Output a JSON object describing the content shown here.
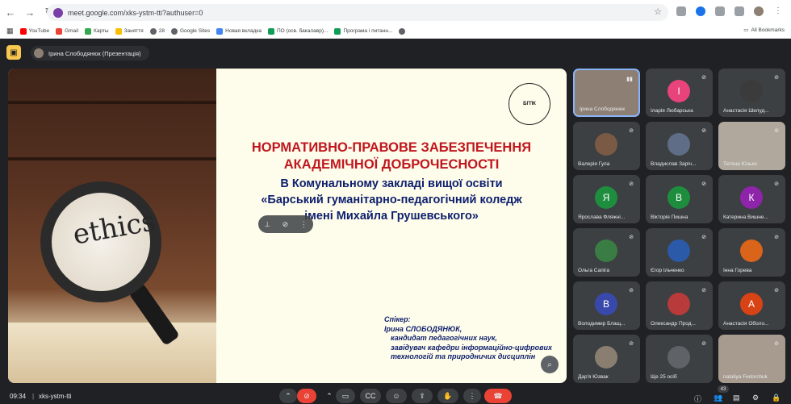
{
  "browser": {
    "url": "meet.google.com/xks-ystm-tti?authuser=0",
    "bookmarks": [
      "YouTube",
      "Gmail",
      "Карты",
      "Заняття",
      "28",
      "Google Sites",
      "Новая вкладка",
      "ПО (осв. бакалавр)...",
      "Програма і питанн..."
    ],
    "all_bookmarks": "All Bookmarks"
  },
  "meet": {
    "presenter_chip": "Ірина Слободянюк (Презентація)",
    "meeting_code": "xks-ystm-tti",
    "time": "09:34",
    "participant_count": "43"
  },
  "slide": {
    "image_word": "ethics",
    "logo_text": "БГПК",
    "title_red": [
      "НОРМАТИВНО-ПРАВОВЕ ЗАБЕЗПЕЧЕННЯ",
      "АКАДЕМІЧНОЇ ДОБРОЧЕСНОСТІ"
    ],
    "title_blue": [
      "В Комунальному закладі вищої освіти",
      "«Барський гуманітарно-педагогічний коледж",
      "імені Михайла Грушевського»"
    ],
    "speaker_label": "Спікер:",
    "speaker_name": "Ірина СЛОБОДЯНЮК,",
    "speaker_lines": [
      "кандидат педагогічних наук,",
      "завідувач кафедри інформаційно-цифрових",
      "технологій та природничих дисциплін"
    ]
  },
  "participants": [
    {
      "name": "Ірина Слободянюк",
      "initial": "",
      "color": "#8d7f73"
    },
    {
      "name": "Іларія Любарська",
      "initial": "І",
      "color": "#e8437a"
    },
    {
      "name": "Анастасія Шелуд...",
      "initial": "",
      "color": "#3b3b3b"
    },
    {
      "name": "Валерія Гула",
      "initial": "",
      "color": "#7a5a45"
    },
    {
      "name": "Владислав Заріч...",
      "initial": "",
      "color": "#5f6e86"
    },
    {
      "name": "Тетяна Юзько",
      "initial": "",
      "color": "#b0a89c"
    },
    {
      "name": "Ярослава Фляжні...",
      "initial": "Я",
      "color": "#1e8e3e"
    },
    {
      "name": "Вікторія Пишна",
      "initial": "В",
      "color": "#1e8e3e"
    },
    {
      "name": "Катерина Вишне...",
      "initial": "К",
      "color": "#8e24aa"
    },
    {
      "name": "Ольга Сапіга",
      "initial": "",
      "color": "#3a7d44"
    },
    {
      "name": "Єгор Ільченко",
      "initial": "",
      "color": "#2b5aa8"
    },
    {
      "name": "Інна Горева",
      "initial": "",
      "color": "#d9641a"
    },
    {
      "name": "Володимир Блащ...",
      "initial": "В",
      "color": "#3949ab"
    },
    {
      "name": "Олександр Прод...",
      "initial": "",
      "color": "#b83a3a"
    },
    {
      "name": "Анастасія Оболо...",
      "initial": "А",
      "color": "#d84315"
    },
    {
      "name": "Дар'я Юзвак",
      "initial": "",
      "color": "#8a7e70"
    },
    {
      "name": "Ще 25 осіб",
      "initial": "",
      "color": "#5f6368"
    },
    {
      "name": "nataliya Fedorchuk",
      "initial": "",
      "color": "#a79b8f"
    }
  ],
  "colors": {
    "title_red": "#c0161f",
    "title_blue": "#0d1f6e",
    "end_call": "#ea4335",
    "active_tile": "#8ab4f8"
  }
}
